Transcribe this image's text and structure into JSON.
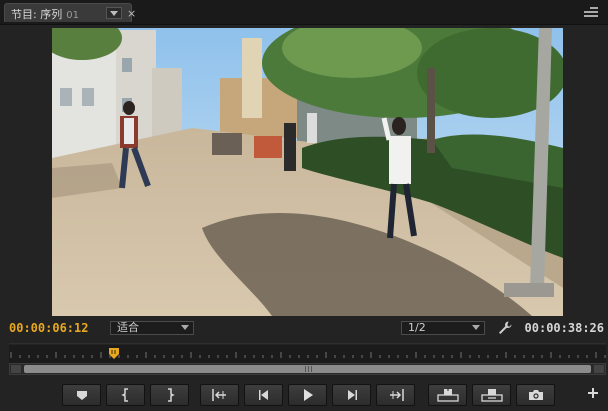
{
  "panel": {
    "tab_title": "节目: 序列",
    "tab_sequence": "01",
    "close_glyph": "×",
    "menu_icon": "panel-menu-icon"
  },
  "monitor": {
    "current_time": "00:00:06:12",
    "duration": "00:00:38:26",
    "zoom_select": {
      "value": "适合"
    },
    "resolution_select": {
      "value": "1/2"
    },
    "settings_icon": "wrench-icon",
    "accent_color": "#e8a820"
  },
  "scrollbar": {
    "grip_glyph": "|||"
  },
  "transport": {
    "buttons": [
      {
        "name": "add-marker",
        "icon": "marker-icon"
      },
      {
        "name": "mark-in",
        "icon": "mark-in-icon"
      },
      {
        "name": "mark-out",
        "icon": "mark-out-icon"
      },
      {
        "name": "go-to-in",
        "icon": "go-to-in-icon"
      },
      {
        "name": "step-back",
        "icon": "step-back-icon"
      },
      {
        "name": "play",
        "icon": "play-icon"
      },
      {
        "name": "step-forward",
        "icon": "step-forward-icon"
      },
      {
        "name": "go-to-out",
        "icon": "go-to-out-icon"
      },
      {
        "name": "lift",
        "icon": "lift-icon"
      },
      {
        "name": "extract",
        "icon": "extract-icon"
      },
      {
        "name": "export-frame",
        "icon": "camera-icon"
      },
      {
        "name": "button-editor",
        "icon": "plus-icon"
      }
    ]
  }
}
